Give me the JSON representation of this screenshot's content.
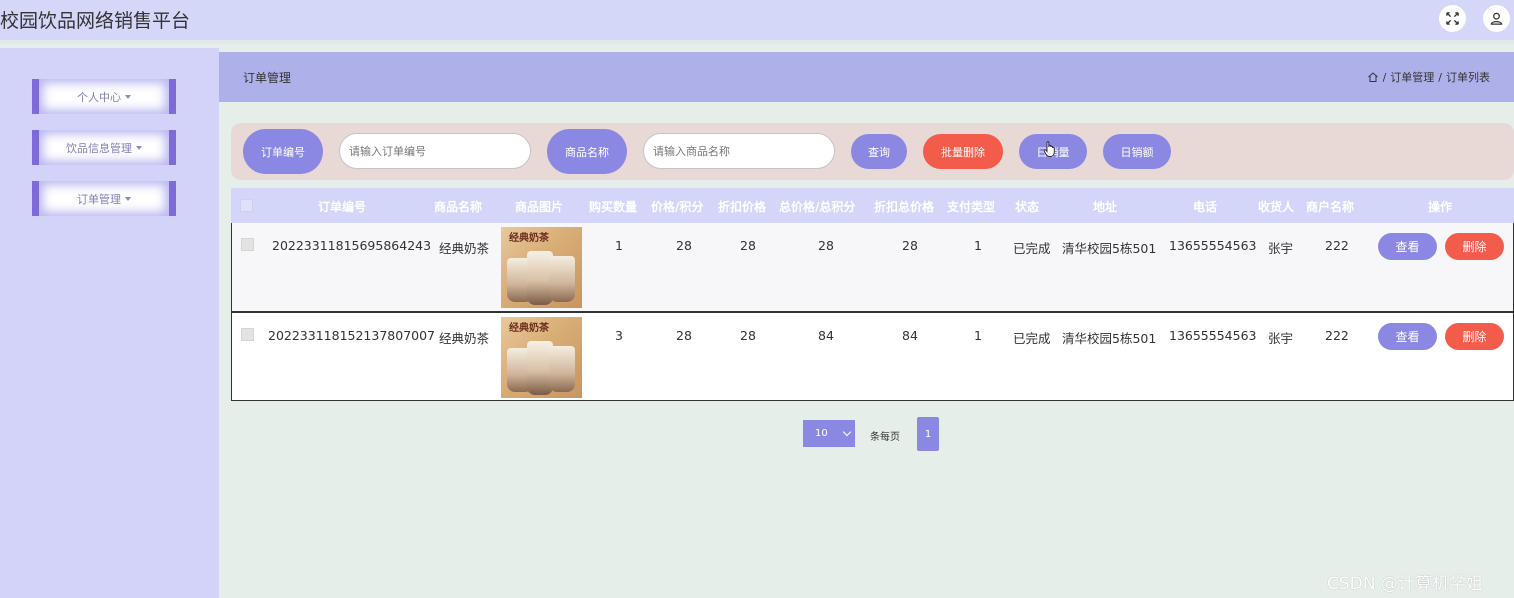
{
  "header": {
    "app_title": "校园饮品网络销售平台",
    "icons": [
      "fullscreen-icon",
      "user-icon"
    ]
  },
  "sidebar": {
    "items": [
      {
        "label": "个人中心"
      },
      {
        "label": "饮品信息管理"
      },
      {
        "label": "订单管理"
      }
    ]
  },
  "main": {
    "page_title": "订单管理",
    "breadcrumb": [
      "订单管理",
      "订单列表"
    ]
  },
  "search": {
    "order_no_label": "订单编号",
    "order_no_placeholder": "请输入订单编号",
    "product_label": "商品名称",
    "product_placeholder": "请输入商品名称",
    "query_button": "查询",
    "batch_delete_button": "批量删除",
    "sales_volume_button": "日销量",
    "sales_amount_button": "日销额"
  },
  "table": {
    "columns": [
      "订单编号",
      "商品名称",
      "商品图片",
      "购买数量",
      "价格/积分",
      "折扣价格",
      "总价格/总积分",
      "折扣总价格",
      "支付类型",
      "状态",
      "地址",
      "电话",
      "收货人",
      "商户名称",
      "操作"
    ],
    "rows": [
      {
        "order_no": "20223311815695864243",
        "product": "经典奶茶",
        "image_text": "经典奶茶",
        "quantity": "1",
        "price": "28",
        "discount_price": "28",
        "total": "28",
        "discount_total": "28",
        "pay_type": "1",
        "status": "已完成",
        "address": "清华校园5栋501",
        "phone": "13655554563",
        "receiver": "张宇",
        "merchant": "222"
      },
      {
        "order_no": "20223311815213780​7007",
        "product": "经典奶茶",
        "image_text": "经典奶茶",
        "quantity": "3",
        "price": "28",
        "discount_price": "28",
        "total": "84",
        "discount_total": "84",
        "pay_type": "1",
        "status": "已完成",
        "address": "清华校园5栋501",
        "phone": "13655554563",
        "receiver": "张宇",
        "merchant": "222"
      }
    ],
    "view_button": "查看",
    "delete_button": "删除"
  },
  "pagination": {
    "page_size": "10",
    "per_page_label": "条每页",
    "current_page": "1"
  },
  "watermark": "CSDN @计算机学姐",
  "colors": {
    "accent": "#8b88e3",
    "danger": "#f35b4a",
    "sidebar": "#d3d3f9",
    "header": "#d5d7f8"
  }
}
